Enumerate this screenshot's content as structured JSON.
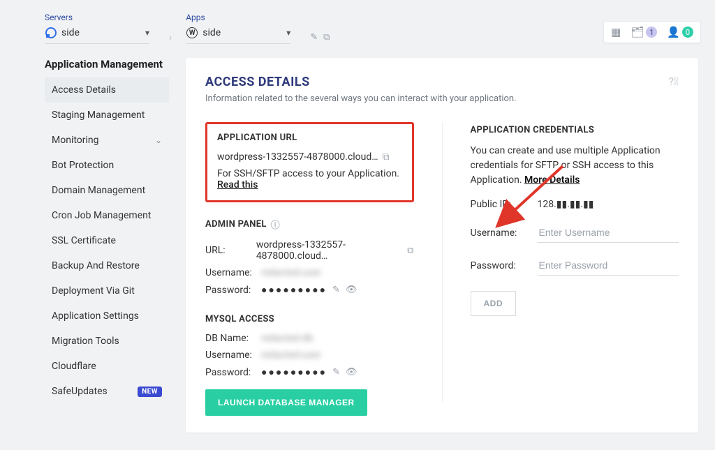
{
  "breadcrumbs": {
    "servers_label": "Servers",
    "server_selected": "side",
    "apps_label": "Apps",
    "app_selected": "side"
  },
  "top_widgets": {
    "projects_badge": "1",
    "user_badge": "0"
  },
  "sidebar": {
    "heading": "Application Management",
    "items": [
      {
        "label": "Access Details",
        "active": true
      },
      {
        "label": "Staging Management"
      },
      {
        "label": "Monitoring",
        "expandable": true
      },
      {
        "label": "Bot Protection"
      },
      {
        "label": "Domain Management"
      },
      {
        "label": "Cron Job Management"
      },
      {
        "label": "SSL Certificate"
      },
      {
        "label": "Backup And Restore"
      },
      {
        "label": "Deployment Via Git"
      },
      {
        "label": "Application Settings"
      },
      {
        "label": "Migration Tools"
      },
      {
        "label": "Cloudflare"
      },
      {
        "label": "SafeUpdates",
        "badge": "NEW"
      }
    ]
  },
  "panel": {
    "title": "ACCESS DETAILS",
    "subtitle": "Information related to the several ways you can interact with your application."
  },
  "app_url": {
    "heading": "APPLICATION URL",
    "url": "wordpress-1332557-4878000.cloud…",
    "note_prefix": "For SSH/SFTP access to your Application. ",
    "note_link": "Read this"
  },
  "admin_panel": {
    "heading": "ADMIN PANEL",
    "url_label": "URL:",
    "url_value": "wordpress-1332557-4878000.cloud…",
    "username_label": "Username:",
    "username_value": "redacted-user",
    "password_label": "Password:",
    "password_value": "●●●●●●●●●"
  },
  "mysql": {
    "heading": "MYSQL ACCESS",
    "db_label": "DB Name:",
    "db_value": "redacted-db",
    "user_label": "Username:",
    "user_value": "redacted-user",
    "pass_label": "Password:",
    "pass_value": "●●●●●●●●●",
    "launch_btn": "LAUNCH DATABASE MANAGER"
  },
  "credentials": {
    "heading": "APPLICATION CREDENTIALS",
    "text_prefix": "You can create and use multiple Application credentials for SFTP or SSH access to this Application. ",
    "more_link": "More Details",
    "public_ip_label": "Public IP:",
    "public_ip_value": "128.▮▮.▮▮.▮▮",
    "username_label": "Username:",
    "username_placeholder": "Enter Username",
    "password_label": "Password:",
    "password_placeholder": "Enter Password",
    "add_btn": "ADD"
  }
}
